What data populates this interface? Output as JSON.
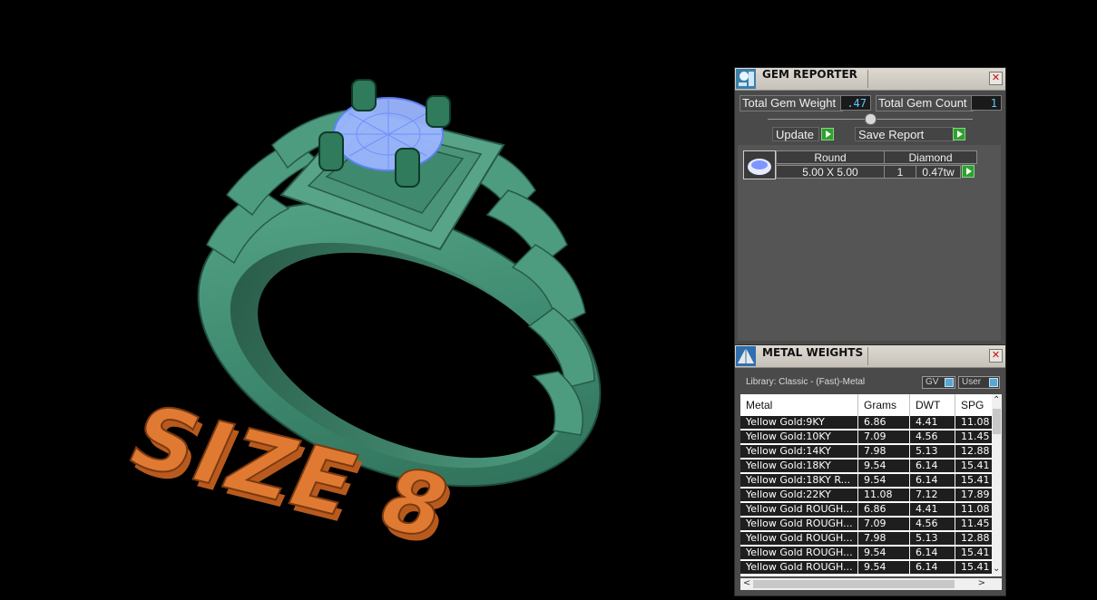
{
  "viewport": {
    "size_text": "SIZE 8",
    "colors": {
      "ring": "#3f8f74",
      "gem": "#8fb0ff",
      "text3d": "#e07a32",
      "background": "#000000"
    }
  },
  "gem_reporter": {
    "title": "GEM REPORTER",
    "close_label": "✕",
    "total_gem_weight_label": "Total Gem Weight",
    "total_gem_weight_value": ".47",
    "total_gem_count_label": "Total Gem Count",
    "total_gem_count_value": "1",
    "update_label": "Update",
    "save_report_label": "Save Report",
    "gems": [
      {
        "shape": "Round",
        "type": "Diamond",
        "size": "5.00 X 5.00",
        "count": "1",
        "weight": "0.47tw"
      }
    ]
  },
  "metal_weights": {
    "title": "METAL WEIGHTS",
    "close_label": "✕",
    "library_label": "Library: Classic - (Fast)-Metal",
    "gv_label": "GV",
    "user_label": "User",
    "columns": [
      "Metal",
      "Grams",
      "DWT",
      "SPG"
    ],
    "rows": [
      [
        "Yellow Gold:9KY",
        "6.86",
        "4.41",
        "11.08"
      ],
      [
        "Yellow Gold:10KY",
        "7.09",
        "4.56",
        "11.45"
      ],
      [
        "Yellow Gold:14KY",
        "7.98",
        "5.13",
        "12.88"
      ],
      [
        "Yellow Gold:18KY",
        "9.54",
        "6.14",
        "15.41"
      ],
      [
        "Yellow Gold:18KY R...",
        "9.54",
        "6.14",
        "15.41"
      ],
      [
        "Yellow Gold:22KY",
        "11.08",
        "7.12",
        "17.89"
      ],
      [
        "Yellow Gold ROUGH...",
        "6.86",
        "4.41",
        "11.08"
      ],
      [
        "Yellow Gold ROUGH...",
        "7.09",
        "4.56",
        "11.45"
      ],
      [
        "Yellow Gold ROUGH...",
        "7.98",
        "5.13",
        "12.88"
      ],
      [
        "Yellow Gold ROUGH...",
        "9.54",
        "6.14",
        "15.41"
      ],
      [
        "Yellow Gold ROUGH...",
        "9.54",
        "6.14",
        "15.41"
      ]
    ]
  }
}
